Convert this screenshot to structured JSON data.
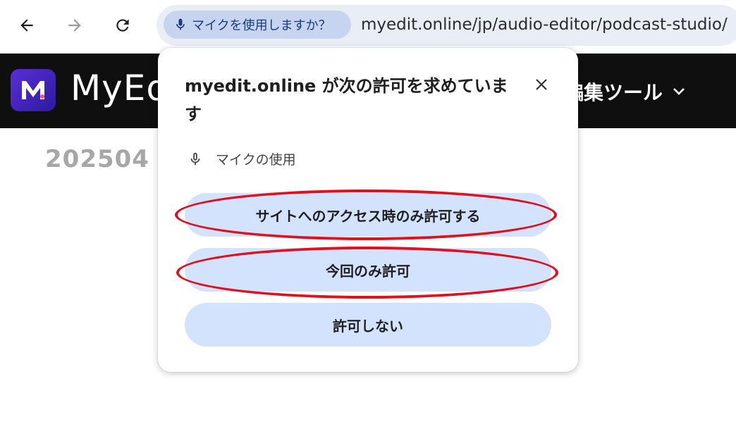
{
  "browser": {
    "mic_chip_label": "マイクを使用しますか？",
    "url": "myedit.online/jp/audio-editor/podcast-studio/"
  },
  "site": {
    "brand": "MyEd",
    "tools_menu_label": "編集ツール",
    "page_title": "202504"
  },
  "permission_popup": {
    "title": "myedit.online が次の許可を求めています",
    "permission_label": "マイクの使用",
    "buttons": {
      "allow_while_visiting": "サイトへのアクセス時のみ許可する",
      "allow_this_time": "今回のみ許可",
      "deny": "許可しない"
    }
  },
  "colors": {
    "highlight_ring": "#e0101c",
    "button_bg": "#d3e2fd",
    "header_bg": "#0f0f10"
  }
}
